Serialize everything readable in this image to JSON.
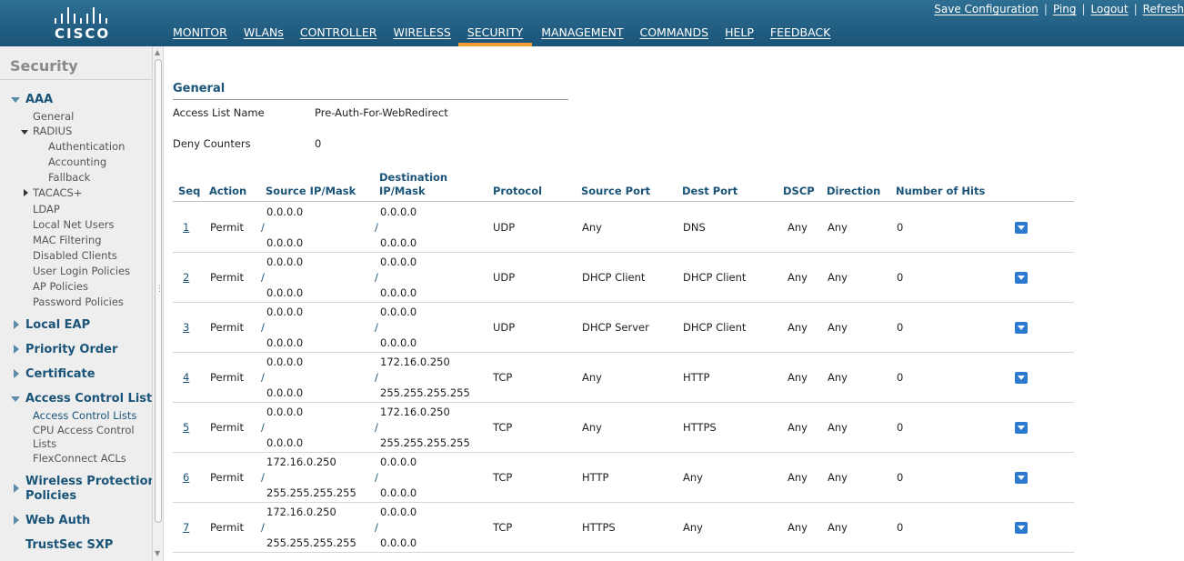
{
  "header": {
    "logo_text": "cisco",
    "nav": [
      "MONITOR",
      "WLANs",
      "CONTROLLER",
      "WIRELESS",
      "SECURITY",
      "MANAGEMENT",
      "COMMANDS",
      "HELP",
      "FEEDBACK"
    ],
    "active_nav": "SECURITY",
    "utils": [
      "Save Configuration",
      "Ping",
      "Logout",
      "Refresh"
    ]
  },
  "sidebar": {
    "title": "Security",
    "aaa": "AAA",
    "general": "General",
    "radius": "RADIUS",
    "authentication": "Authentication",
    "accounting": "Accounting",
    "fallback": "Fallback",
    "tacacs": "TACACS+",
    "ldap": "LDAP",
    "local_net_users": "Local Net Users",
    "mac_filtering": "MAC Filtering",
    "disabled_clients": "Disabled Clients",
    "user_login_policies": "User Login Policies",
    "ap_policies": "AP Policies",
    "password_policies": "Password Policies",
    "local_eap": "Local EAP",
    "priority_order": "Priority Order",
    "certificate": "Certificate",
    "acl": "Access Control Lists",
    "acl_sub": "Access Control Lists",
    "cpu_acl_1": "CPU Access Control",
    "cpu_acl_2": "Lists",
    "flexconnect_acls": "FlexConnect ACLs",
    "wireless_protection_1": "Wireless Protection",
    "wireless_protection_2": "Policies",
    "web_auth": "Web Auth",
    "trustsec": "TrustSec SXP"
  },
  "main": {
    "section_title": "General",
    "acl_name_label": "Access List Name",
    "acl_name_value": "Pre-Auth-For-WebRedirect",
    "deny_label": "Deny Counters",
    "deny_value": "0",
    "columns": {
      "seq": "Seq",
      "action": "Action",
      "src": "Source IP/Mask",
      "dst_1": "Destination",
      "dst_2": "IP/Mask",
      "protocol": "Protocol",
      "src_port": "Source Port",
      "dst_port": "Dest Port",
      "dscp": "DSCP",
      "direction": "Direction",
      "hits": "Number of Hits"
    },
    "rows": [
      {
        "seq": "1",
        "action": "Permit",
        "src_ip": "0.0.0.0",
        "src_mask": "0.0.0.0",
        "dst_ip": "0.0.0.0",
        "dst_mask": "0.0.0.0",
        "protocol": "UDP",
        "src_port": "Any",
        "dst_port": "DNS",
        "dscp": "Any",
        "direction": "Any",
        "hits": "0"
      },
      {
        "seq": "2",
        "action": "Permit",
        "src_ip": "0.0.0.0",
        "src_mask": "0.0.0.0",
        "dst_ip": "0.0.0.0",
        "dst_mask": "0.0.0.0",
        "protocol": "UDP",
        "src_port": "DHCP Client",
        "dst_port": "DHCP Client",
        "dscp": "Any",
        "direction": "Any",
        "hits": "0"
      },
      {
        "seq": "3",
        "action": "Permit",
        "src_ip": "0.0.0.0",
        "src_mask": "0.0.0.0",
        "dst_ip": "0.0.0.0",
        "dst_mask": "0.0.0.0",
        "protocol": "UDP",
        "src_port": "DHCP Server",
        "dst_port": "DHCP Client",
        "dscp": "Any",
        "direction": "Any",
        "hits": "0"
      },
      {
        "seq": "4",
        "action": "Permit",
        "src_ip": "0.0.0.0",
        "src_mask": "0.0.0.0",
        "dst_ip": "172.16.0.250",
        "dst_mask": "255.255.255.255",
        "protocol": "TCP",
        "src_port": "Any",
        "dst_port": "HTTP",
        "dscp": "Any",
        "direction": "Any",
        "hits": "0"
      },
      {
        "seq": "5",
        "action": "Permit",
        "src_ip": "0.0.0.0",
        "src_mask": "0.0.0.0",
        "dst_ip": "172.16.0.250",
        "dst_mask": "255.255.255.255",
        "protocol": "TCP",
        "src_port": "Any",
        "dst_port": "HTTPS",
        "dscp": "Any",
        "direction": "Any",
        "hits": "0"
      },
      {
        "seq": "6",
        "action": "Permit",
        "src_ip": "172.16.0.250",
        "src_mask": "255.255.255.255",
        "dst_ip": "0.0.0.0",
        "dst_mask": "0.0.0.0",
        "protocol": "TCP",
        "src_port": "HTTP",
        "dst_port": "Any",
        "dscp": "Any",
        "direction": "Any",
        "hits": "0"
      },
      {
        "seq": "7",
        "action": "Permit",
        "src_ip": "172.16.0.250",
        "src_mask": "255.255.255.255",
        "dst_ip": "0.0.0.0",
        "dst_mask": "0.0.0.0",
        "protocol": "TCP",
        "src_port": "HTTPS",
        "dst_port": "Any",
        "dscp": "Any",
        "direction": "Any",
        "hits": "0"
      }
    ],
    "slash": "/"
  },
  "colors": {
    "header_top": "#2f6f94",
    "header_bottom": "#1a5478",
    "active_tab": "#f29c35",
    "link": "#1a5478",
    "dropdown_button": "#2b7ad0"
  }
}
